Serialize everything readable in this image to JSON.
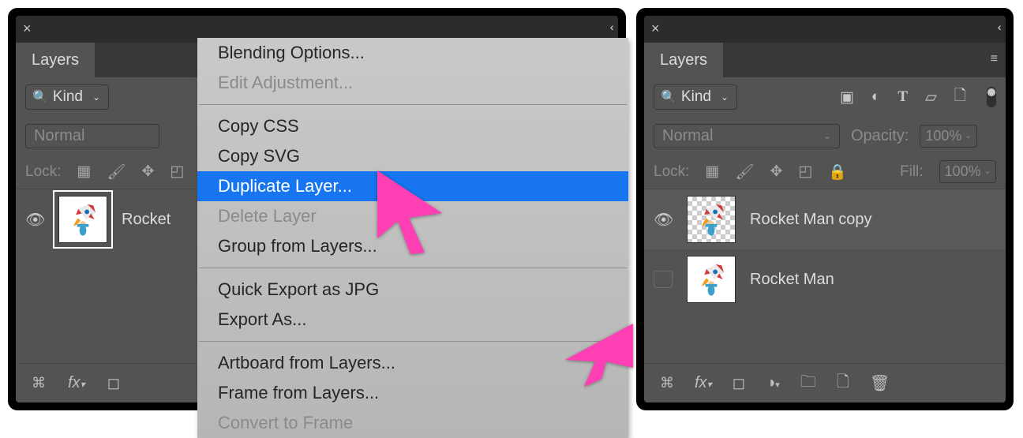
{
  "shared": {
    "panel_title": "Layers",
    "kind_label": "Kind",
    "blend_mode": "Normal",
    "opacity_label": "Opacity:",
    "opacity_value": "100%",
    "fill_label": "Fill:",
    "fill_value": "100%",
    "lock_label": "Lock:"
  },
  "left": {
    "layer_name": "Rocket",
    "context_menu": {
      "items": [
        {
          "label": "Blending Options...",
          "disabled": false
        },
        {
          "label": "Edit Adjustment...",
          "disabled": true
        },
        {
          "sep": true
        },
        {
          "label": "Copy CSS",
          "disabled": false
        },
        {
          "label": "Copy SVG",
          "disabled": false
        },
        {
          "label": "Duplicate Layer...",
          "disabled": false,
          "selected": true
        },
        {
          "label": "Delete Layer",
          "disabled": true
        },
        {
          "label": "Group from Layers...",
          "disabled": false
        },
        {
          "sep": true
        },
        {
          "label": "Quick Export as JPG",
          "disabled": false
        },
        {
          "label": "Export As...",
          "disabled": false
        },
        {
          "sep": true
        },
        {
          "label": "Artboard from Layers...",
          "disabled": false
        },
        {
          "label": "Frame from Layers...",
          "disabled": false
        },
        {
          "label": "Convert to Frame",
          "disabled": true
        }
      ]
    }
  },
  "right": {
    "layers": [
      {
        "name": "Rocket Man copy",
        "visible": true,
        "transparent_bg": true,
        "selected": true
      },
      {
        "name": "Rocket Man",
        "visible": false,
        "transparent_bg": false,
        "selected": false
      }
    ]
  }
}
